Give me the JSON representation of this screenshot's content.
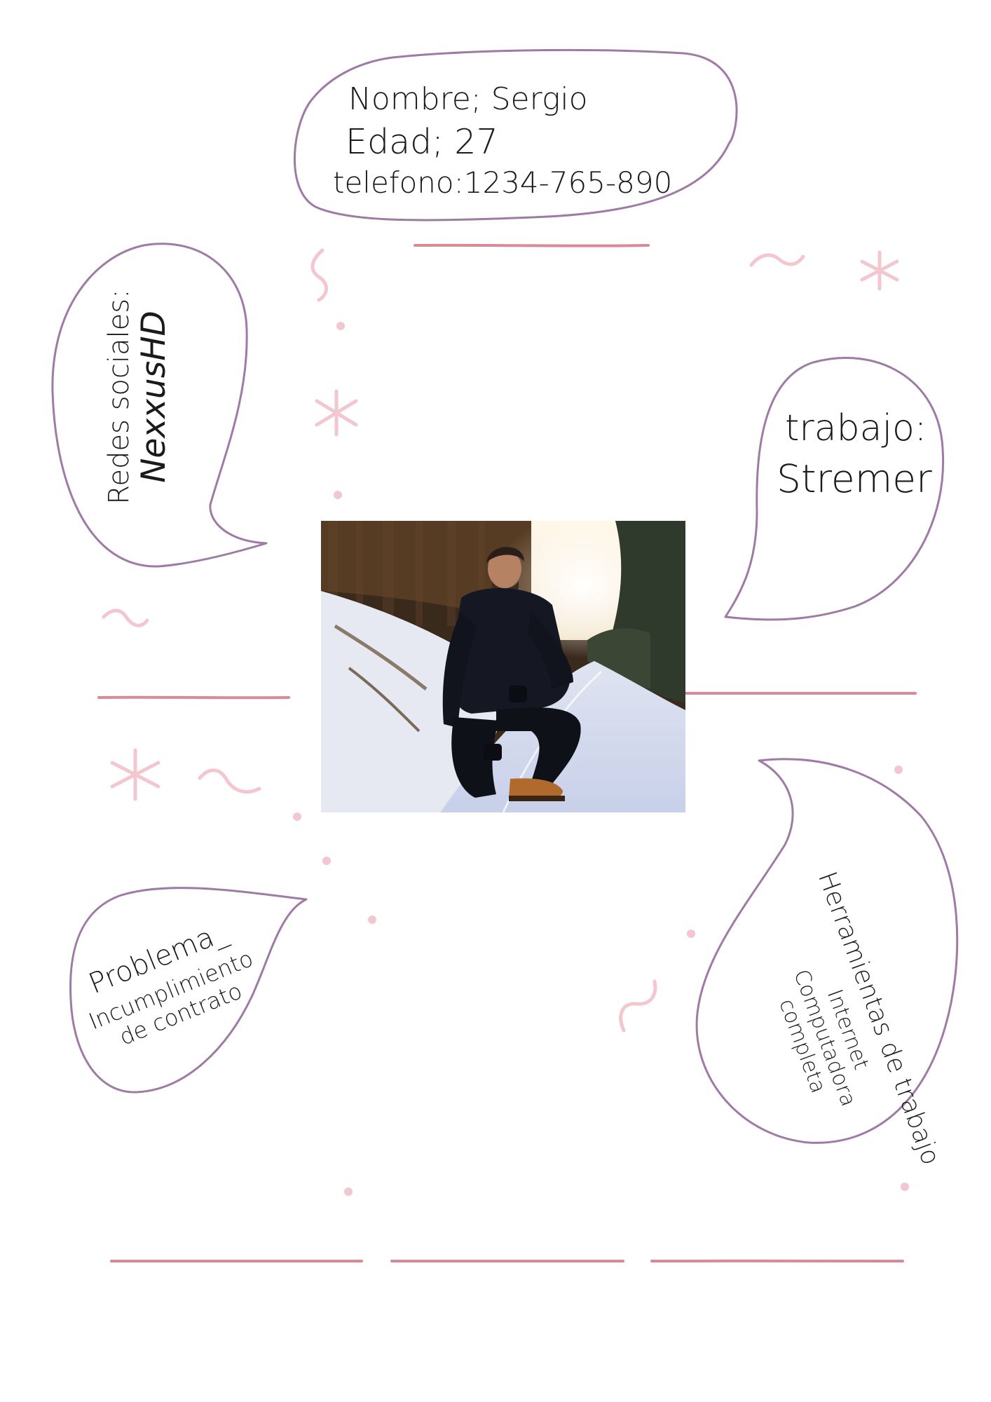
{
  "profile": {
    "name_line": "Nombre; Sergio",
    "age_line": "Edad; 27",
    "phone_line": "telefono:1234-765-890",
    "social_label": "Redes sociales:",
    "social_value": "NexxusHD",
    "job_label": "trabajo:",
    "job_value": "Stremer",
    "problem_label": "Problema_",
    "problem_line1": "Incumplimiento",
    "problem_line2": "de contrato",
    "tools_label": "Herramientas de trabajo",
    "tools_line1": "Internet",
    "tools_line2": "Computadora",
    "tools_line3": "completa"
  },
  "colors": {
    "bubble_stroke": "#a07aa6",
    "underline": "#d98a95",
    "doodle": "#f3c7cf"
  },
  "icons": {
    "doodles": [
      "tilde-doodle",
      "asterisk-doodle",
      "dot-doodle"
    ]
  }
}
